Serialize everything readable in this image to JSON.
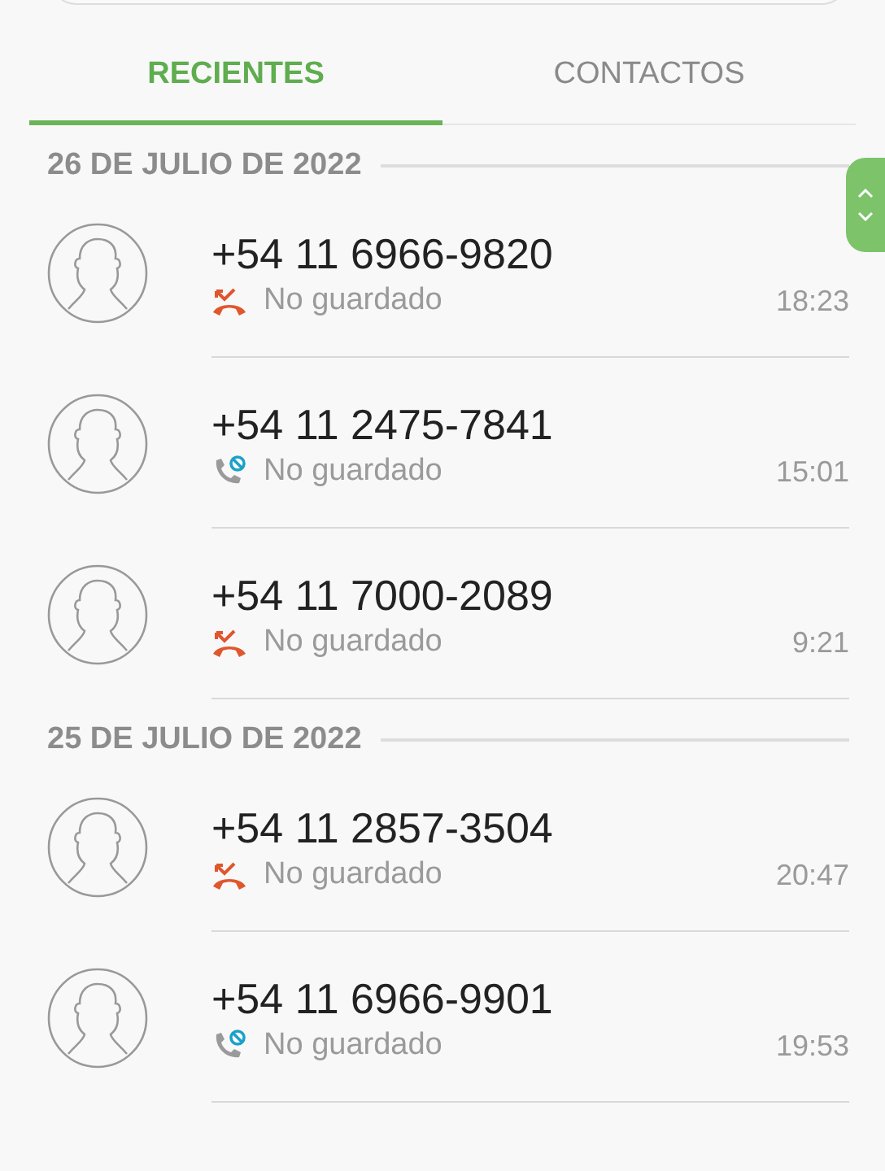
{
  "tabs": [
    {
      "label": "RECIENTES",
      "selected": true
    },
    {
      "label": "CONTACTOS",
      "selected": false
    }
  ],
  "groups": [
    {
      "date": "26 DE JULIO DE 2022",
      "calls": [
        {
          "number": "+54 11 6966-9820",
          "kind": "missed",
          "status": "No guardado",
          "time": "18:23"
        },
        {
          "number": "+54 11 2475-7841",
          "kind": "rejected",
          "status": "No guardado",
          "time": "15:01"
        },
        {
          "number": "+54 11 7000-2089",
          "kind": "missed",
          "status": "No guardado",
          "time": "9:21"
        }
      ]
    },
    {
      "date": "25 DE JULIO DE 2022",
      "calls": [
        {
          "number": "+54 11 2857-3504",
          "kind": "missed",
          "status": "No guardado",
          "time": "20:47"
        },
        {
          "number": "+54 11 6966-9901",
          "kind": "rejected",
          "status": "No guardado",
          "time": "19:53"
        }
      ]
    }
  ]
}
